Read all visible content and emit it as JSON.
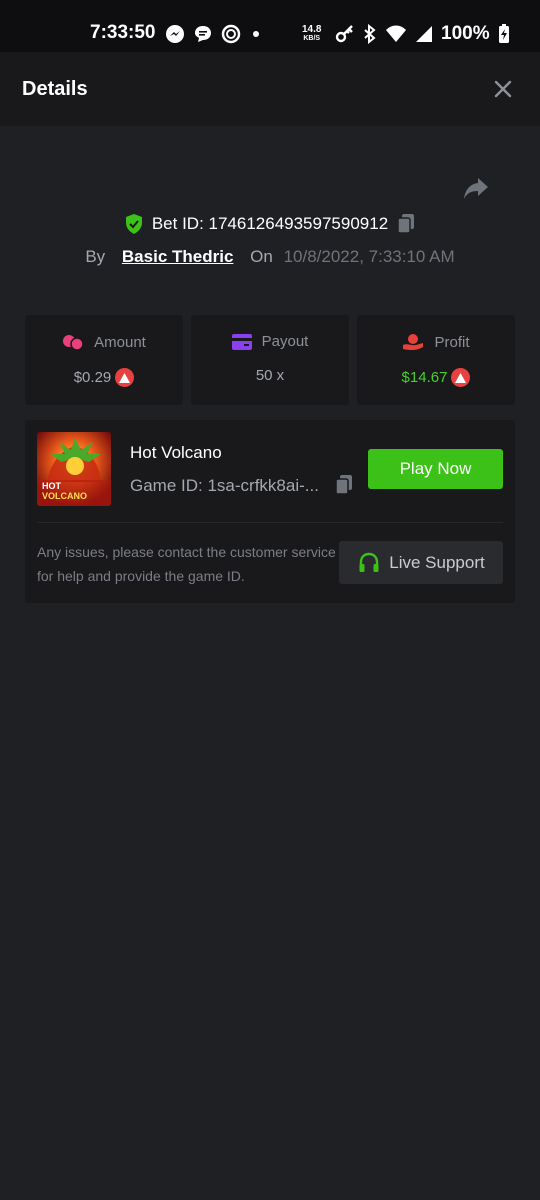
{
  "status_bar": {
    "time": "7:33:50",
    "net_speed": "14.8",
    "net_speed_unit": "KB/S",
    "battery": "100%"
  },
  "header": {
    "title": "Details"
  },
  "bet": {
    "id_label": "Bet ID: 1746126493597590912",
    "by_label": "By",
    "user": "Basic Thedric",
    "on_label": "On",
    "date": "10/8/2022, 7:33:10 AM"
  },
  "stats": {
    "amount_label": "Amount",
    "amount_value": "$0.29",
    "payout_label": "Payout",
    "payout_value": "50 x",
    "profit_label": "Profit",
    "profit_value": "$14.67"
  },
  "game": {
    "name": "Hot Volcano",
    "id_label": "Game ID: 1sa-crfkk8ai-...",
    "thumb_line1": "HOT",
    "thumb_line2": "VOLCANO",
    "play_label": "Play Now"
  },
  "support": {
    "message": "Any issues, please contact the customer service for help and provide the game ID.",
    "button_label": "Live Support"
  },
  "colors": {
    "background": "#1f2023",
    "card": "#19191b",
    "accent_green": "#3bc117",
    "profit_green": "#46d12a",
    "avax_red": "#e84142",
    "amount_pink": "#e8407a",
    "payout_purple": "#8a3ff0",
    "profit_red": "#e8413a"
  }
}
